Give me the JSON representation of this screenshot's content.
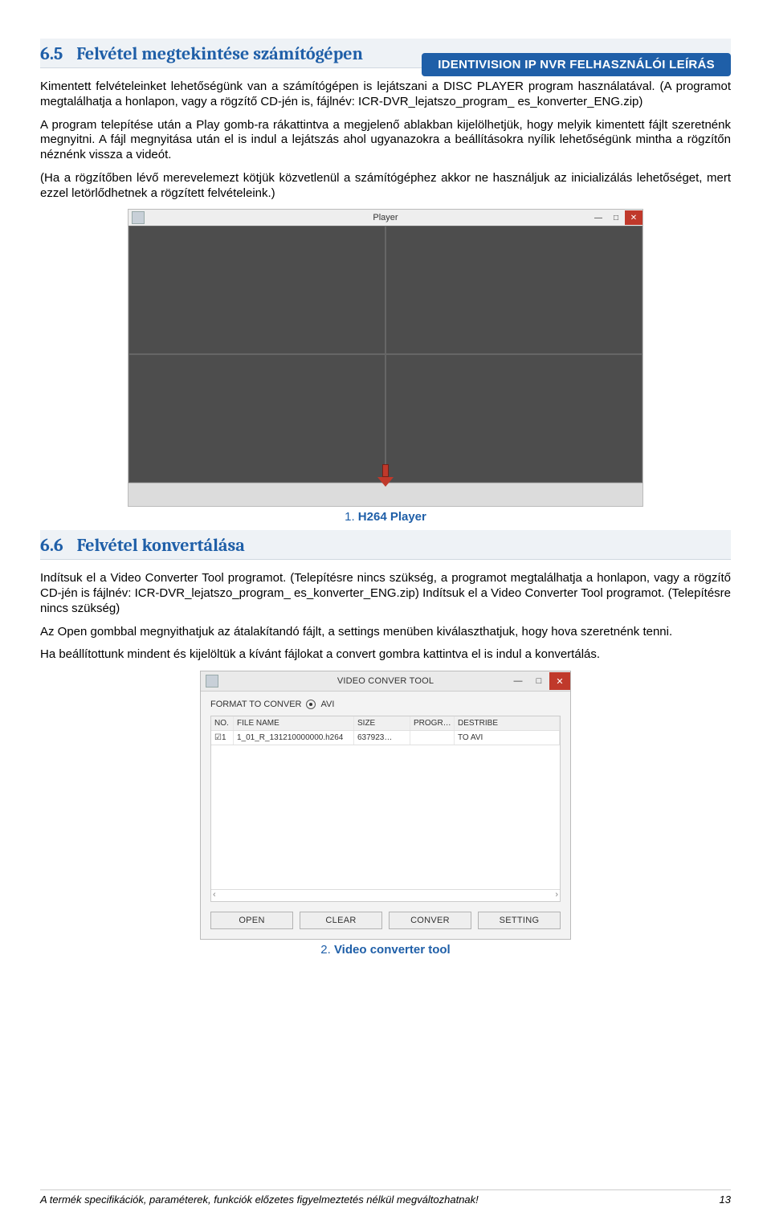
{
  "header": {
    "badge": "IDENTIVISION IP NVR FELHASZNÁLÓI LEÍRÁS"
  },
  "sections": {
    "s65": {
      "num": "6.5",
      "title": "Felvétel megtekintése számítógépen"
    },
    "s66": {
      "num": "6.6",
      "title": "Felvétel konvertálása"
    }
  },
  "para": {
    "p1": "Kimentett felvételeinket lehetőségünk van a számítógépen is lejátszani a DISC PLAYER program használatával. (A programot megtalálhatja a honlapon, vagy a rögzítő CD-jén is, fájlnév: ICR-DVR_lejatszo_program_ es_konverter_ENG.zip)",
    "p2": "A program telepítése után a Play gomb-ra rákattintva a megjelenő ablakban kijelölhetjük, hogy melyik kimentett fájlt szeretnénk megnyitni. A fájl megnyitása után el is indul a lejátszás ahol ugyanazokra a beállításokra nyílik lehetőségünk mintha a rögzítőn néznénk vissza a videót.",
    "p3": "(Ha a rögzítőben lévő merevelemezt kötjük közvetlenül a számítógéphez akkor ne használjuk az inicializálás lehetőséget, mert ezzel letörlődhetnek a rögzített felvételeink.)",
    "p4": "Indítsuk el a Video Converter Tool programot. (Telepítésre nincs szükség, a programot megtalálhatja a honlapon, vagy a rögzítő CD-jén is fájlnév: ICR-DVR_lejatszo_program_ es_konverter_ENG.zip) Indítsuk el a Video Converter Tool programot. (Telepítésre nincs szükség)",
    "p5": "Az Open gombbal megnyithatjuk az átalakítandó fájlt, a settings menüben kiválaszthatjuk, hogy hova szeretnénk tenni.",
    "p6": "Ha beállítottunk mindent és kijelöltük a kívánt fájlokat a convert gombra kattintva el is indul a konvertálás."
  },
  "captions": {
    "c1_num": "1.",
    "c1_text": "H264 Player",
    "c2_num": "2.",
    "c2_text": "Video converter tool"
  },
  "player": {
    "title": "Player"
  },
  "converter": {
    "title": "VIDEO CONVER TOOL",
    "format_label": "FORMAT TO CONVER",
    "format_avi": "AVI",
    "headers": {
      "no": "NO.",
      "filename": "FILE NAME",
      "size": "SIZE",
      "progr": "PROGR…",
      "destribe": "DESTRIBE"
    },
    "row1": {
      "no": "1",
      "filename": "1_01_R_131210000000.h264",
      "size": "637923…",
      "progr": "",
      "destribe": "TO AVI"
    },
    "buttons": {
      "open": "OPEN",
      "clear": "CLEAR",
      "conver": "CONVER",
      "setting": "SETTING"
    }
  },
  "footer": {
    "text": "A termék specifikációk, paraméterek, funkciók előzetes figyelmeztetés nélkül megváltozhatnak!",
    "page": "13"
  }
}
